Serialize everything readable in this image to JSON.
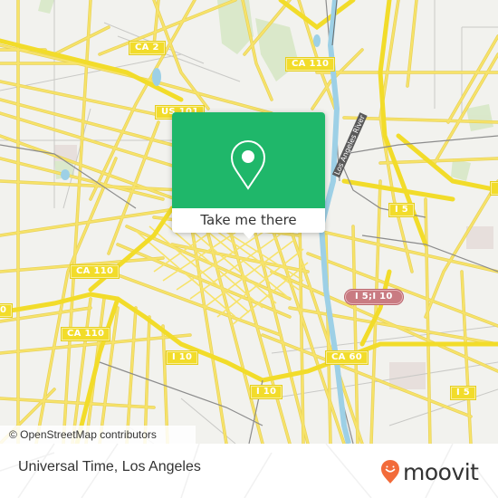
{
  "map": {
    "attribution": "© OpenStreetMap contributors",
    "colors": {
      "background": "#f2f2ee",
      "road": "#f7e36a",
      "road_edge": "#e8d25a",
      "minor_road": "#c9c9c6",
      "rail": "#8c8c8c",
      "river": "#9dd0e6",
      "park": "#d6e7c4"
    },
    "river_label": "Los Angeles River",
    "shields": [
      {
        "label": "CA 2",
        "type": "state"
      },
      {
        "label": "CA 110",
        "type": "state"
      },
      {
        "label": "US 101",
        "type": "us"
      },
      {
        "label": "I 5",
        "type": "interstate"
      },
      {
        "label": "CA 110",
        "type": "state"
      },
      {
        "label": "I 5;I 10",
        "type": "interstate-combo"
      },
      {
        "label": "CA 110",
        "type": "state"
      },
      {
        "label": "CA 60",
        "type": "state"
      },
      {
        "label": "I 10",
        "type": "interstate"
      },
      {
        "label": "I 10",
        "type": "interstate"
      },
      {
        "label": "I 5",
        "type": "interstate"
      },
      {
        "label": "0",
        "type": "partial"
      },
      {
        "label": "",
        "type": "partial"
      }
    ]
  },
  "popup": {
    "icon": "location-pin-icon",
    "cta_label": "Take me there",
    "accent": "#1fb76a"
  },
  "footer": {
    "place_name": "Universal Time, Los Angeles",
    "brand": "moovit",
    "brand_color": "#f26b3a"
  }
}
